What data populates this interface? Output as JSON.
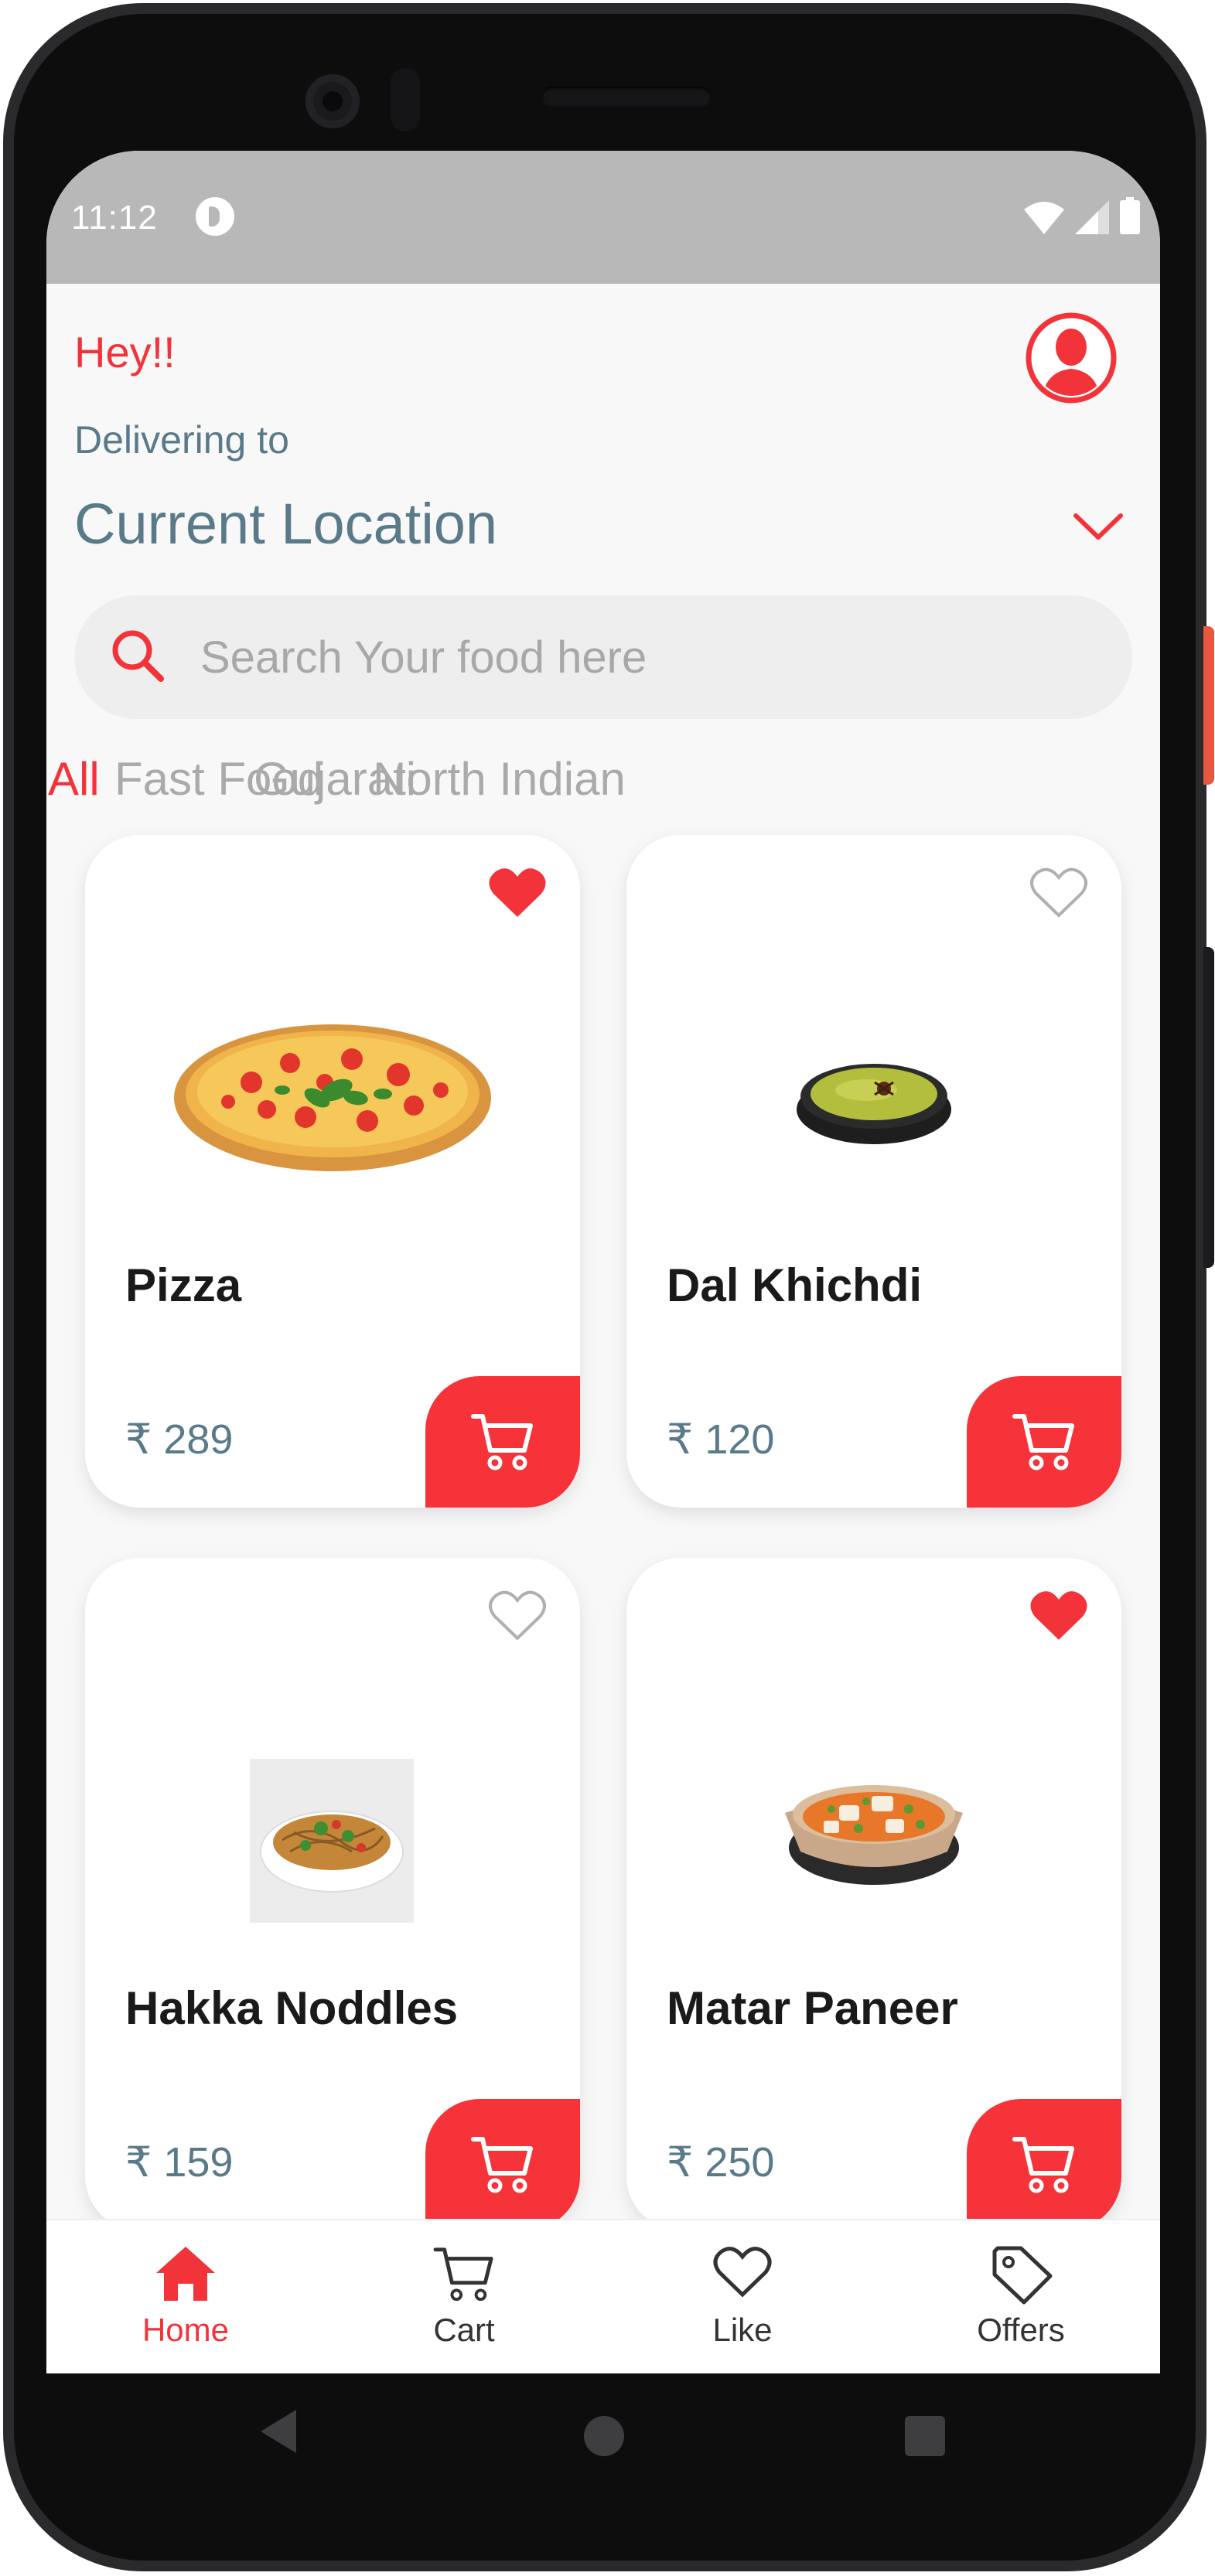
{
  "statusbar": {
    "time": "11:12"
  },
  "header": {
    "greeting": "Hey!!",
    "delivering_label": "Delivering to",
    "location": "Current Location"
  },
  "search": {
    "placeholder": "Search Your food here",
    "value": ""
  },
  "categories": [
    {
      "label": "All",
      "active": true
    },
    {
      "label": "Fast Food",
      "active": false
    },
    {
      "label": "Gujarati",
      "active": false
    },
    {
      "label": "North Indian",
      "active": false
    }
  ],
  "products": [
    {
      "name": "Pizza",
      "price": "₹ 289",
      "liked": true
    },
    {
      "name": "Dal Khichdi",
      "price": "₹ 120",
      "liked": false
    },
    {
      "name": "Hakka Noddles",
      "price": "₹ 159",
      "liked": false
    },
    {
      "name": "Matar Paneer",
      "price": "₹ 250",
      "liked": true
    }
  ],
  "nav": [
    {
      "label": "Home",
      "icon": "home-icon",
      "active": true
    },
    {
      "label": "Cart",
      "icon": "cart-icon",
      "active": false
    },
    {
      "label": "Like",
      "icon": "heart-icon",
      "active": false
    },
    {
      "label": "Offers",
      "icon": "tag-icon",
      "active": false
    }
  ],
  "colors": {
    "accent": "#f2333a",
    "muted_text": "#5a7a8a",
    "inactive": "#aaaaaa",
    "status_bar": "#b8b8b8"
  }
}
